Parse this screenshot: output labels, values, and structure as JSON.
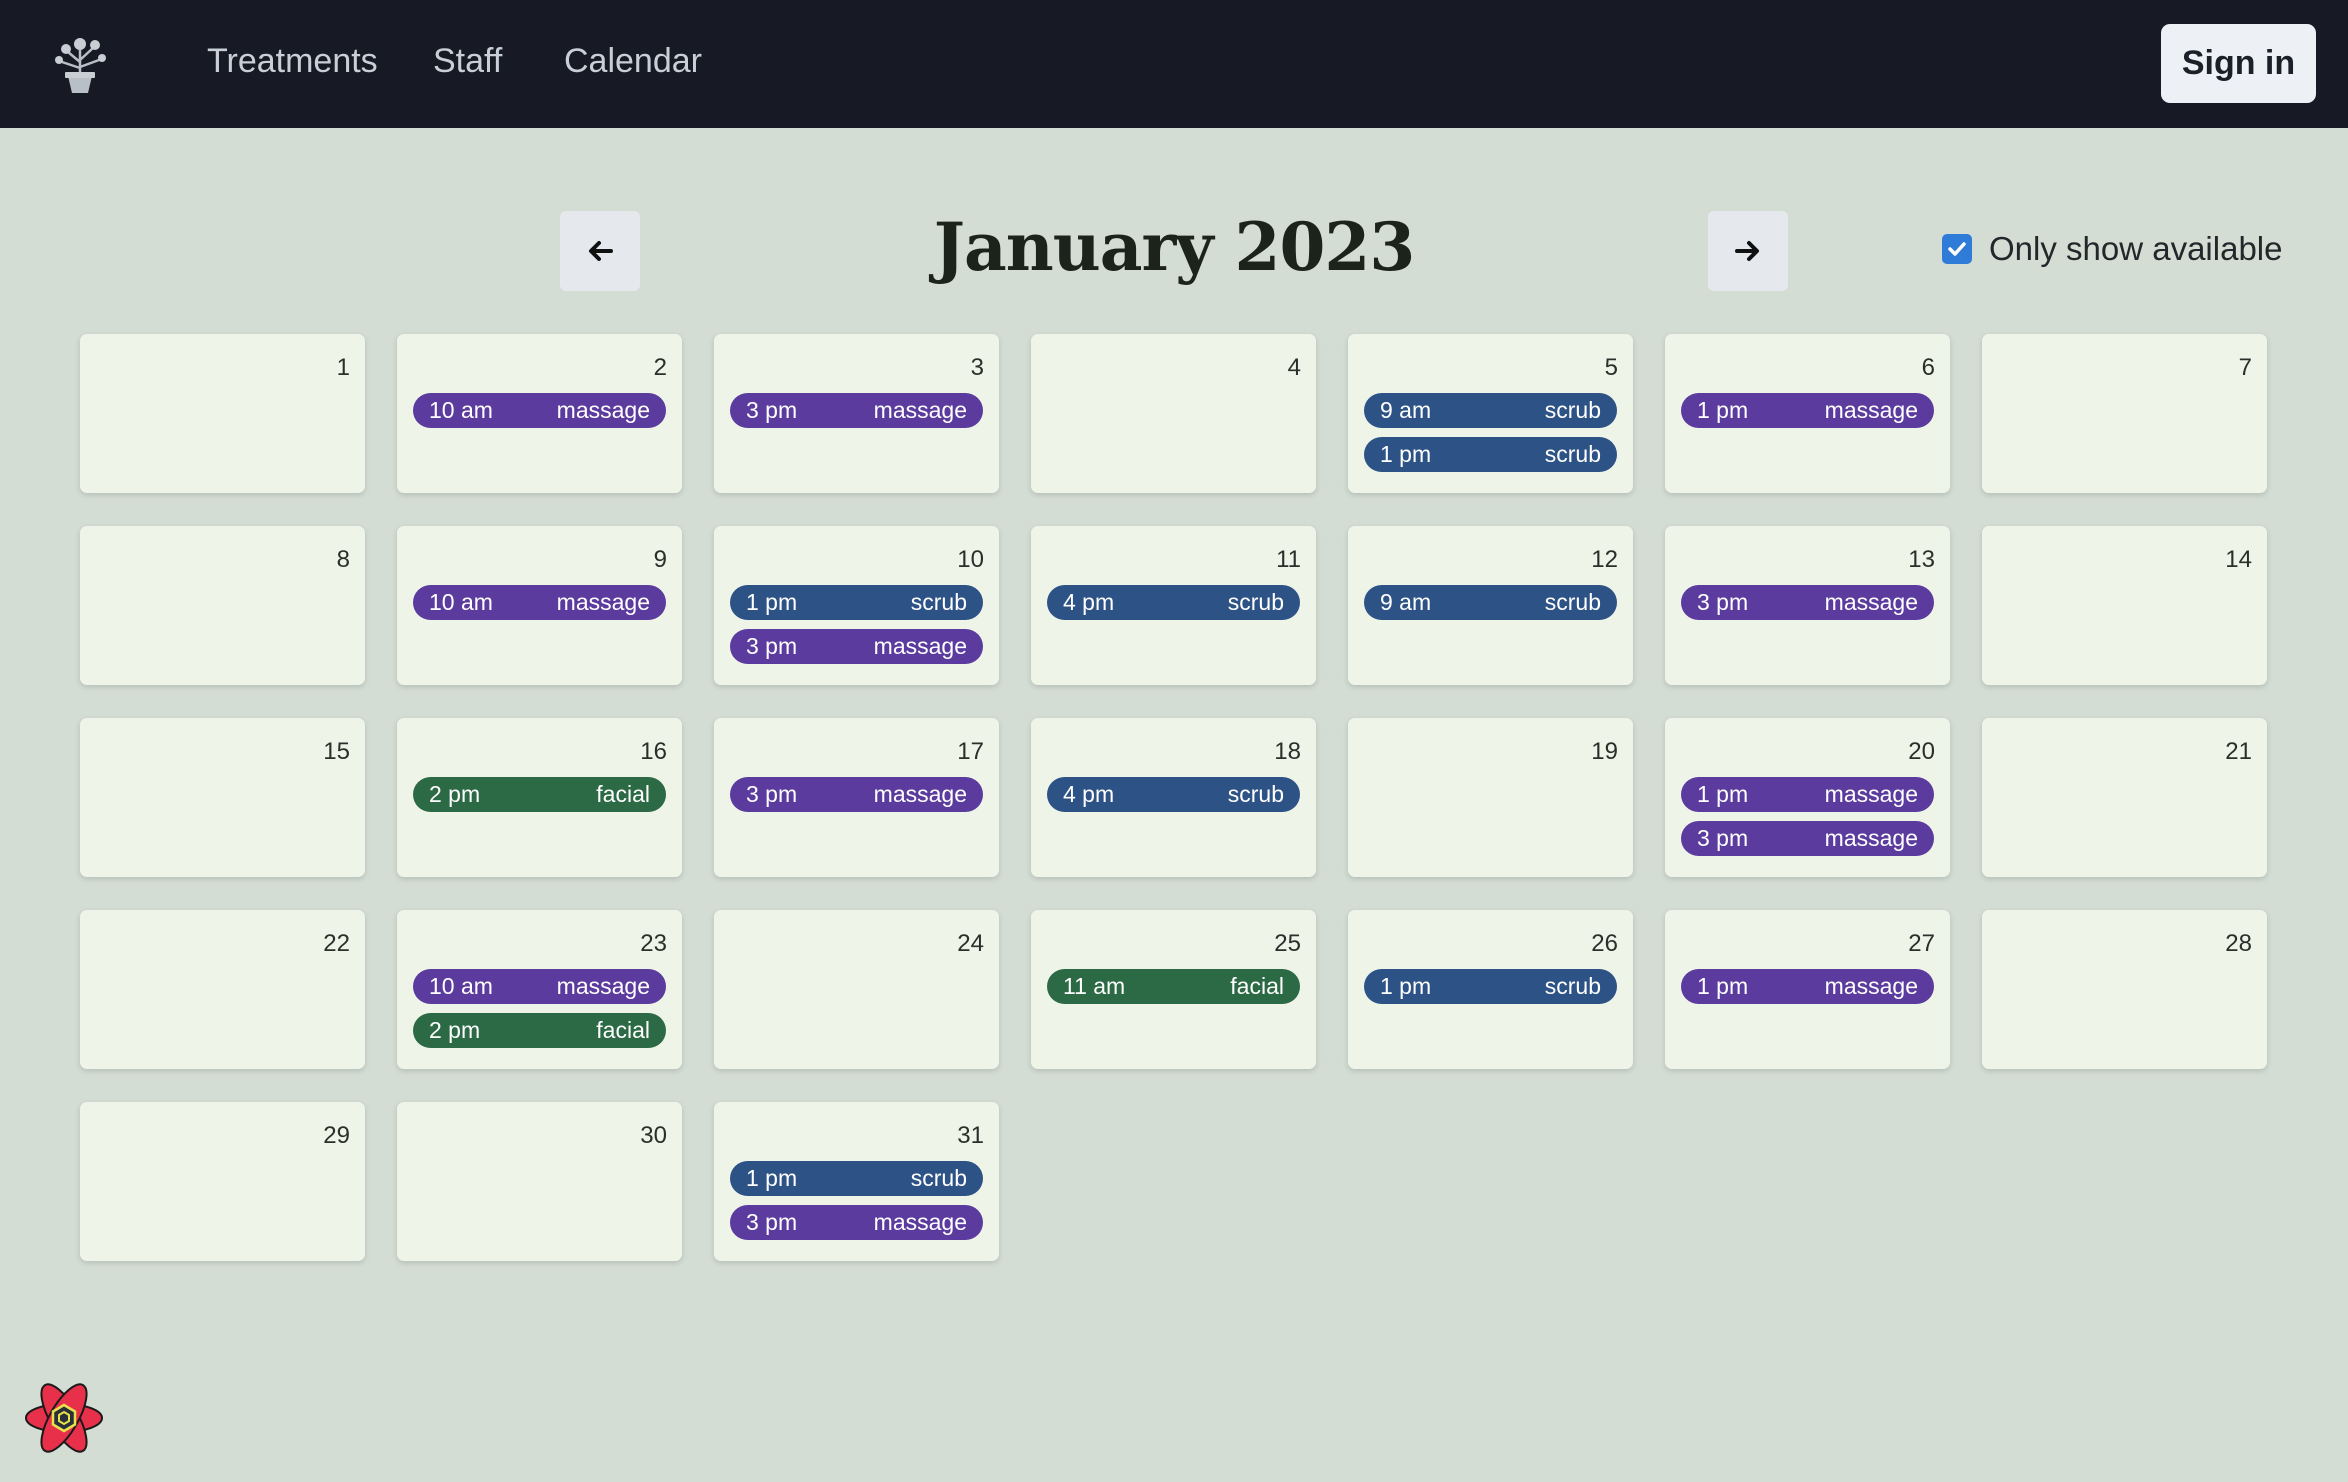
{
  "nav": {
    "links": [
      "Treatments",
      "Staff",
      "Calendar"
    ],
    "sign_in_label": "Sign in"
  },
  "calendar": {
    "title": "January 2023",
    "only_available_label": "Only show available",
    "only_available_checked": true,
    "days": [
      {
        "day": "1",
        "appts": []
      },
      {
        "day": "2",
        "appts": [
          {
            "time": "10 am",
            "type": "massage"
          }
        ]
      },
      {
        "day": "3",
        "appts": [
          {
            "time": "3 pm",
            "type": "massage"
          }
        ]
      },
      {
        "day": "4",
        "appts": []
      },
      {
        "day": "5",
        "appts": [
          {
            "time": "9 am",
            "type": "scrub"
          },
          {
            "time": "1 pm",
            "type": "scrub"
          }
        ]
      },
      {
        "day": "6",
        "appts": [
          {
            "time": "1 pm",
            "type": "massage"
          }
        ]
      },
      {
        "day": "7",
        "appts": []
      },
      {
        "day": "8",
        "appts": []
      },
      {
        "day": "9",
        "appts": [
          {
            "time": "10 am",
            "type": "massage"
          }
        ]
      },
      {
        "day": "10",
        "appts": [
          {
            "time": "1 pm",
            "type": "scrub"
          },
          {
            "time": "3 pm",
            "type": "massage"
          }
        ]
      },
      {
        "day": "11",
        "appts": [
          {
            "time": "4 pm",
            "type": "scrub"
          }
        ]
      },
      {
        "day": "12",
        "appts": [
          {
            "time": "9 am",
            "type": "scrub"
          }
        ]
      },
      {
        "day": "13",
        "appts": [
          {
            "time": "3 pm",
            "type": "massage"
          }
        ]
      },
      {
        "day": "14",
        "appts": []
      },
      {
        "day": "15",
        "appts": []
      },
      {
        "day": "16",
        "appts": [
          {
            "time": "2 pm",
            "type": "facial"
          }
        ]
      },
      {
        "day": "17",
        "appts": [
          {
            "time": "3 pm",
            "type": "massage"
          }
        ]
      },
      {
        "day": "18",
        "appts": [
          {
            "time": "4 pm",
            "type": "scrub"
          }
        ]
      },
      {
        "day": "19",
        "appts": []
      },
      {
        "day": "20",
        "appts": [
          {
            "time": "1 pm",
            "type": "massage"
          },
          {
            "time": "3 pm",
            "type": "massage"
          }
        ]
      },
      {
        "day": "21",
        "appts": []
      },
      {
        "day": "22",
        "appts": []
      },
      {
        "day": "23",
        "appts": [
          {
            "time": "10 am",
            "type": "massage"
          },
          {
            "time": "2 pm",
            "type": "facial"
          }
        ]
      },
      {
        "day": "24",
        "appts": []
      },
      {
        "day": "25",
        "appts": [
          {
            "time": "11 am",
            "type": "facial"
          }
        ]
      },
      {
        "day": "26",
        "appts": [
          {
            "time": "1 pm",
            "type": "scrub"
          }
        ]
      },
      {
        "day": "27",
        "appts": [
          {
            "time": "1 pm",
            "type": "massage"
          }
        ]
      },
      {
        "day": "28",
        "appts": []
      },
      {
        "day": "29",
        "appts": []
      },
      {
        "day": "30",
        "appts": []
      },
      {
        "day": "31",
        "appts": [
          {
            "time": "1 pm",
            "type": "scrub"
          },
          {
            "time": "3 pm",
            "type": "massage"
          }
        ]
      }
    ]
  },
  "icons": {
    "logo": "flower-pot-icon",
    "prev": "arrow-left-icon",
    "next": "arrow-right-icon",
    "checkbox": "check-icon",
    "devtools": "react-logo-icon"
  },
  "colors": {
    "topbar": "#171a24",
    "page_bg": "#d3ddd4",
    "day_bg": "#eff4e9",
    "massage": "#5b3b9e",
    "scrub": "#2d5285",
    "facial": "#2b6a44",
    "checkbox": "#2f7bd8"
  }
}
